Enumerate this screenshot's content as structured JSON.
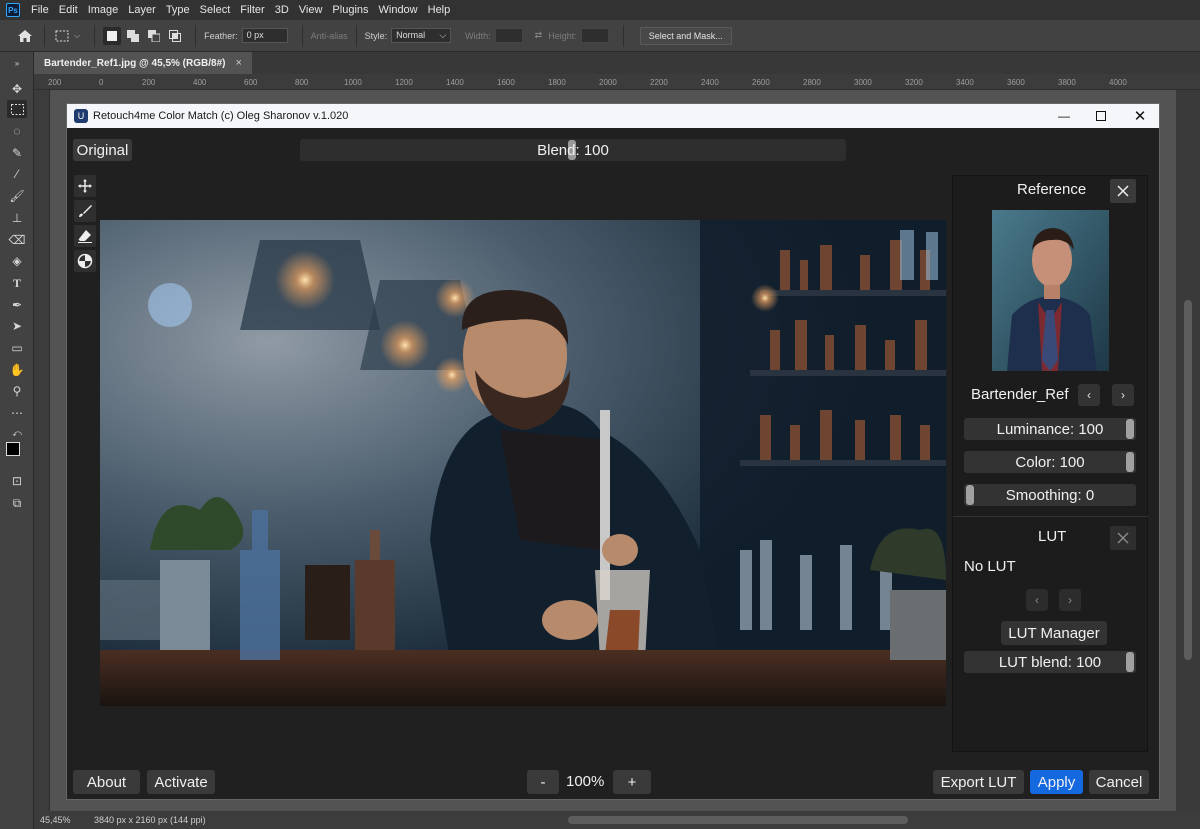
{
  "app": {
    "logo": "Ps",
    "menu": [
      "File",
      "Edit",
      "Image",
      "Layer",
      "Type",
      "Select",
      "Filter",
      "3D",
      "View",
      "Plugins",
      "Window",
      "Help"
    ]
  },
  "options": {
    "feather_label": "Feather:",
    "feather_value": "0 px",
    "antialias_label": "Anti-alias",
    "style_label": "Style:",
    "style_value": "Normal",
    "width_label": "Width:",
    "height_label": "Height:",
    "select_mask_label": "Select and Mask..."
  },
  "document": {
    "tab_title": "Bartender_Ref1.jpg @ 45,5% (RGB/8#)",
    "zoom": "45,45%",
    "info": "3840 px x 2160 px (144 ppi)",
    "ruler_top": [
      "200",
      "0",
      "200",
      "400",
      "600",
      "800",
      "1000",
      "1200",
      "1400",
      "1600",
      "1800",
      "2000",
      "2200",
      "2400",
      "2600",
      "2800",
      "3000",
      "3200",
      "3400",
      "3600",
      "3800",
      "4000"
    ]
  },
  "plugin": {
    "title": "Retouch4me Color Match (c) Oleg Sharonov v.1.020",
    "original_label": "Original",
    "blend_label": "Blend: 100",
    "reference": {
      "title": "Reference",
      "name": "Bartender_Ref",
      "luminance_label": "Luminance: 100",
      "color_label": "Color: 100",
      "smoothing_label": "Smoothing: 0"
    },
    "lut": {
      "title": "LUT",
      "status": "No LUT",
      "manager_label": "LUT Manager",
      "blend_label": "LUT blend: 100"
    },
    "bottom": {
      "about_label": "About",
      "activate_label": "Activate",
      "minus_label": "-",
      "zoom_label": "100%",
      "plus_label": "+",
      "export_label": "Export LUT",
      "apply_label": "Apply",
      "cancel_label": "Cancel"
    }
  },
  "colors": {
    "accent": "#1469e0",
    "dialog_bg": "#202020",
    "ps_bg": "#535353"
  }
}
